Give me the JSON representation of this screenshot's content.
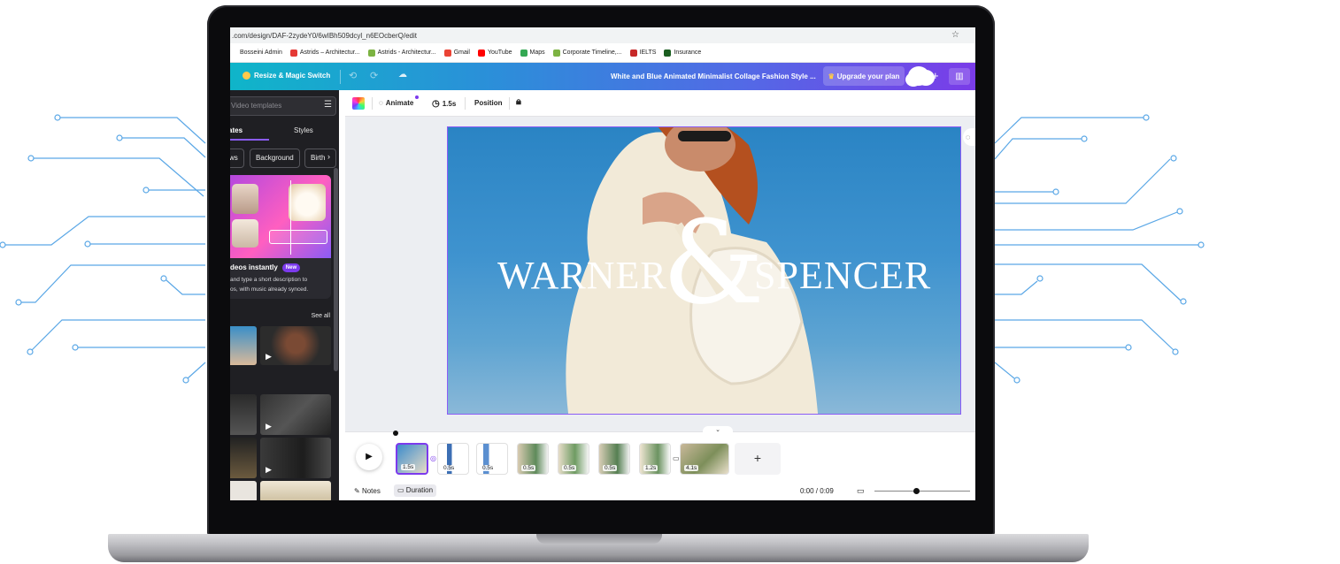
{
  "browser": {
    "url": ".com/design/DAF-2zydeY0/6wIBh509dcyl_n6EOcberQ/edit",
    "bookmarks": [
      {
        "label": "Bosseini Admin",
        "color": "#ffffff"
      },
      {
        "label": "Astrids – Architectur...",
        "color": "#e53935"
      },
      {
        "label": "Astrids - Architectur...",
        "color": "#7cb342"
      },
      {
        "label": "Gmail",
        "color": "#ea4335"
      },
      {
        "label": "YouTube",
        "color": "#ff0000"
      },
      {
        "label": "Maps",
        "color": "#34a853"
      },
      {
        "label": "Corporate Timeline,...",
        "color": "#7cb342"
      },
      {
        "label": "IELTS",
        "color": "#c62828"
      },
      {
        "label": "Insurance",
        "color": "#1b5e20"
      }
    ]
  },
  "topbar": {
    "resize_label": "Resize & Magic Switch",
    "doc_title": "White and Blue Animated Minimalist Collage Fashion Style ...",
    "upgrade_label": "Upgrade your plan",
    "plus": "+"
  },
  "panel": {
    "search_placeholder": "Video templates",
    "tab_templates": "ates",
    "tab_styles": "Styles",
    "chips": [
      "ws",
      "Background",
      "Birth"
    ],
    "promo_title": "deos instantly",
    "promo_badge": "New",
    "promo_desc_1": "and type a short description to",
    "promo_desc_2": "os, with music already synced.",
    "section_label": "l",
    "see_all": "See all"
  },
  "toolbar": {
    "animate": "Animate",
    "time": "1.5s",
    "position": "Position"
  },
  "canvas": {
    "title_left": "WARNER",
    "ampersand": "&",
    "title_right": "SPENCER"
  },
  "timeline": {
    "clips": [
      "1.5s",
      "0.5s",
      "0.5s",
      "0.5s",
      "0.5s",
      "0.5s",
      "1.2s",
      "4.1s"
    ],
    "notes": "Notes",
    "duration": "Duration",
    "time": "0:00 / 0:09"
  }
}
